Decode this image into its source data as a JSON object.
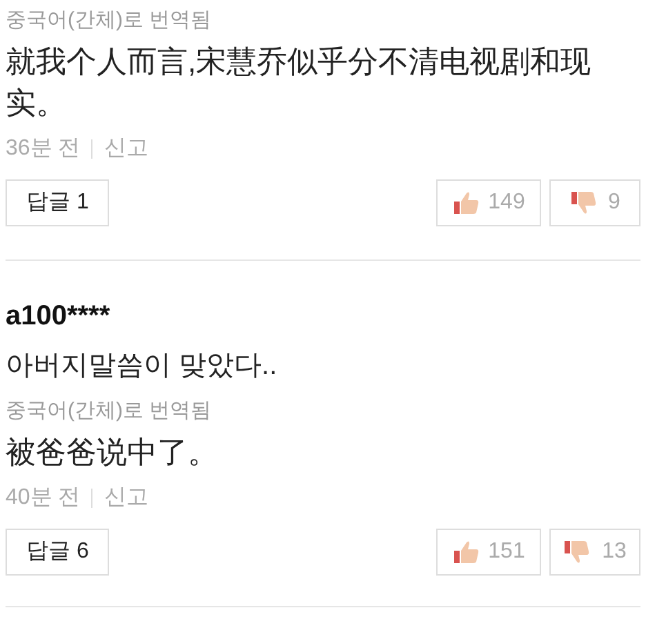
{
  "comments": [
    {
      "translation_note": "중국어(간체)로 번역됨",
      "translated_text": "就我个人而言,宋慧乔似乎分不清电视剧和现实。",
      "time": "36분 전",
      "report": "신고",
      "reply_button": "답글 1",
      "likes": "149",
      "dislikes": "9"
    },
    {
      "author": "a100****",
      "original_text": "아버지말씀이 맞았다..",
      "translation_note": "중국어(간체)로 번역됨",
      "translated_text": "被爸爸说中了。",
      "time": "40분 전",
      "report": "신고",
      "reply_button": "답글 6",
      "likes": "151",
      "dislikes": "13"
    }
  ]
}
